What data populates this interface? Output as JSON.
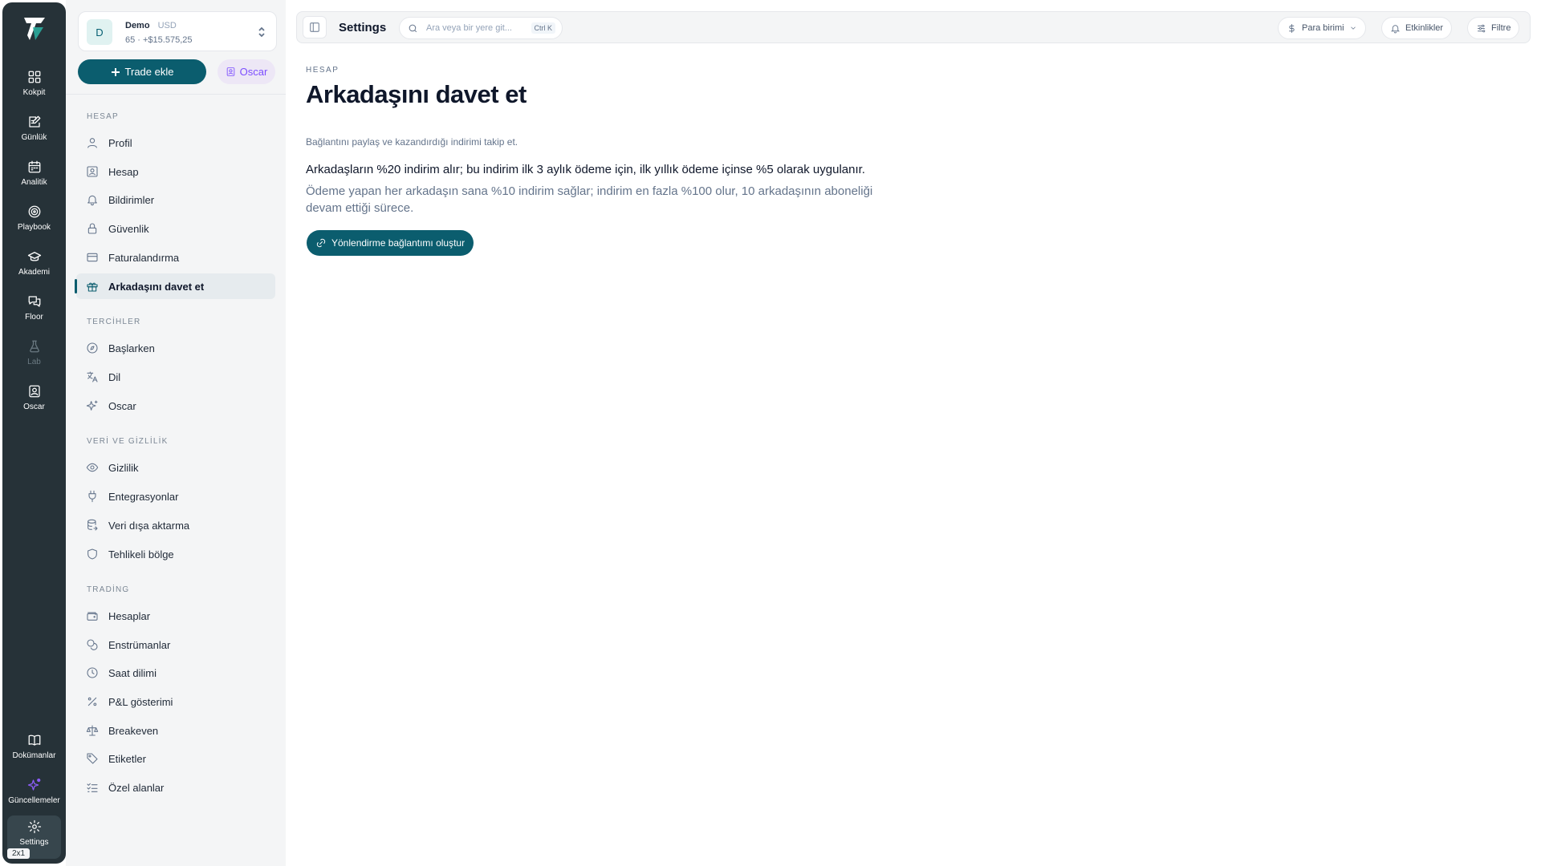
{
  "rail": {
    "items": [
      {
        "label": "Kokpit",
        "icon": "grid-icon"
      },
      {
        "label": "Günlük",
        "icon": "journal-edit-icon"
      },
      {
        "label": "Analitik",
        "icon": "calendar-icon"
      },
      {
        "label": "Playbook",
        "icon": "target-icon"
      },
      {
        "label": "Akademi",
        "icon": "graduation-cap-icon"
      },
      {
        "label": "Floor",
        "icon": "chat-bubbles-icon"
      },
      {
        "label": "Lab",
        "icon": "flask-icon"
      },
      {
        "label": "Oscar",
        "icon": "portrait-icon"
      }
    ],
    "bottom": [
      {
        "label": "Dokümanlar",
        "icon": "book-icon"
      },
      {
        "label": "Güncellemeler",
        "icon": "sparkles-icon"
      },
      {
        "label": "Settings",
        "icon": "gear-icon"
      }
    ],
    "badge": "2x1"
  },
  "account": {
    "avatar": "D",
    "name": "Demo",
    "currency": "USD",
    "summary": "65 · +$15.575,25"
  },
  "actions": {
    "trade_label": "Trade ekle",
    "oscar_label": "Oscar"
  },
  "sections": [
    {
      "title": "HESAP",
      "items": [
        "Profil",
        "Hesap",
        "Bildirimler",
        "Güvenlik",
        "Faturalandırma",
        "Arkadaşını davet et"
      ]
    },
    {
      "title": "TERCİHLER",
      "items": [
        "Başlarken",
        "Dil",
        "Oscar"
      ]
    },
    {
      "title": "VERİ VE GİZLİLİK",
      "items": [
        "Gizlilik",
        "Entegrasyonlar",
        "Veri dışa aktarma",
        "Tehlikeli bölge"
      ]
    },
    {
      "title": "TRADİNG",
      "items": [
        "Hesaplar",
        "Enstrümanlar",
        "Saat dilimi",
        "P&L gösterimi",
        "Breakeven",
        "Etiketler",
        "Özel alanlar"
      ]
    }
  ],
  "active_item": "Arkadaşını davet et",
  "topbar": {
    "title": "Settings",
    "search_placeholder": "Ara veya bir yere git...",
    "search_shortcut": "Ctrl K",
    "currency_label": "Para birimi",
    "events_label": "Etkinlikler",
    "filter_label": "Filtre"
  },
  "main": {
    "breadcrumb": "HESAP",
    "title": "Arkadaşını davet et",
    "subtitle": "Bağlantını paylaş ve kazandırdığı indirimi takip et.",
    "paragraph1": "Arkadaşların %20 indirim alır; bu indirim ilk 3 aylık ödeme için, ilk yıllık ödeme içinse %5 olarak uygulanır.",
    "paragraph2": "Ödeme yapan her arkadaşın sana %10 indirim sağlar; indirim en fazla %100 olur, 10 arkadaşının aboneliği devam ettiği sürece.",
    "button_label": "Yönlendirme bağlantımı oluştur"
  },
  "colors": {
    "rail_bg": "#263238",
    "accent": "#0b5d6e",
    "oscar_bg": "#ede7f6",
    "oscar_fg": "#7c4dff"
  }
}
